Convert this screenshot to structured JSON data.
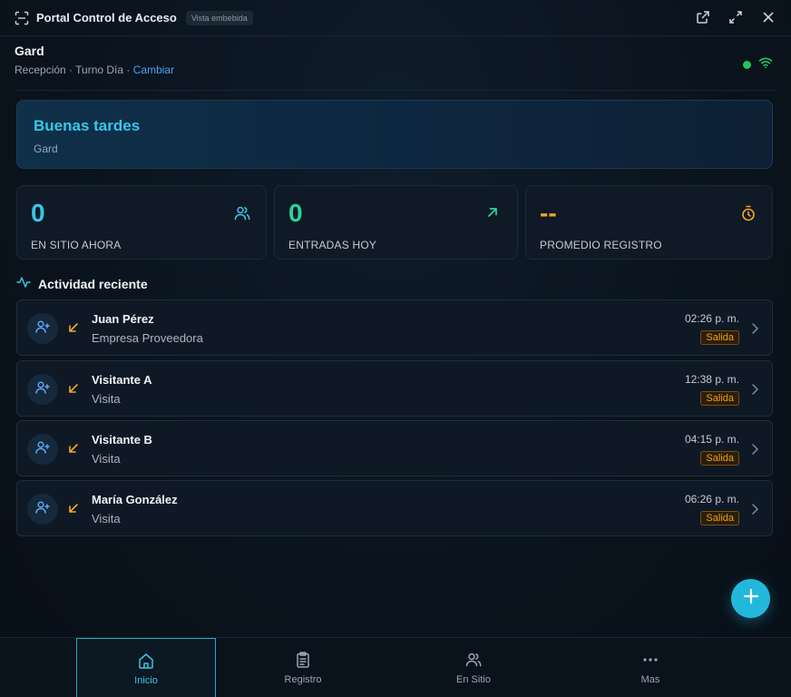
{
  "window": {
    "title": "Portal Control de Acceso",
    "embed_badge": "Vista embebida",
    "icons": [
      "scan-icon",
      "external-link-icon",
      "maximize-icon",
      "close-icon"
    ]
  },
  "user": {
    "name": "Gard",
    "location": "Recepción · Turno Día ·",
    "change_link": "Cambiar",
    "online": true
  },
  "greeting": {
    "title": "Buenas tardes",
    "name": "Gard"
  },
  "stats": [
    {
      "value": "0",
      "label": "EN SITIO AHORA",
      "icon": "users-icon",
      "color": "#38c6e8"
    },
    {
      "value": "0",
      "label": "ENTRADAS HOY",
      "icon": "arrow-up-right-icon",
      "color": "#2ed199"
    },
    {
      "value": "--",
      "label": "PROMEDIO REGISTRO",
      "icon": "stopwatch-icon",
      "color": "#f5a524"
    }
  ],
  "activity": {
    "title": "Actividad reciente",
    "items": [
      {
        "name": "Juan Pérez",
        "company": "Empresa Proveedora",
        "time": "02:26 p. m.",
        "status": "Salida"
      },
      {
        "name": "Visitante A",
        "company": "Visita",
        "time": "12:38 p. m.",
        "status": "Salida"
      },
      {
        "name": "Visitante B",
        "company": "Visita",
        "time": "04:15 p. m.",
        "status": "Salida"
      },
      {
        "name": "María González",
        "company": "Visita",
        "time": "06:26 p. m.",
        "status": "Salida"
      }
    ]
  },
  "nav": [
    {
      "label": "Inicio",
      "icon": "home-icon",
      "active": true
    },
    {
      "label": "Registro",
      "icon": "clipboard-icon",
      "active": false
    },
    {
      "label": "En Sitio",
      "icon": "users-icon",
      "active": false
    },
    {
      "label": "Mas",
      "icon": "more-icon",
      "active": false
    }
  ],
  "colors": {
    "accent": "#38c6e8",
    "link": "#4f9ef0",
    "success": "#22c55e",
    "warning": "#f59e0b"
  }
}
